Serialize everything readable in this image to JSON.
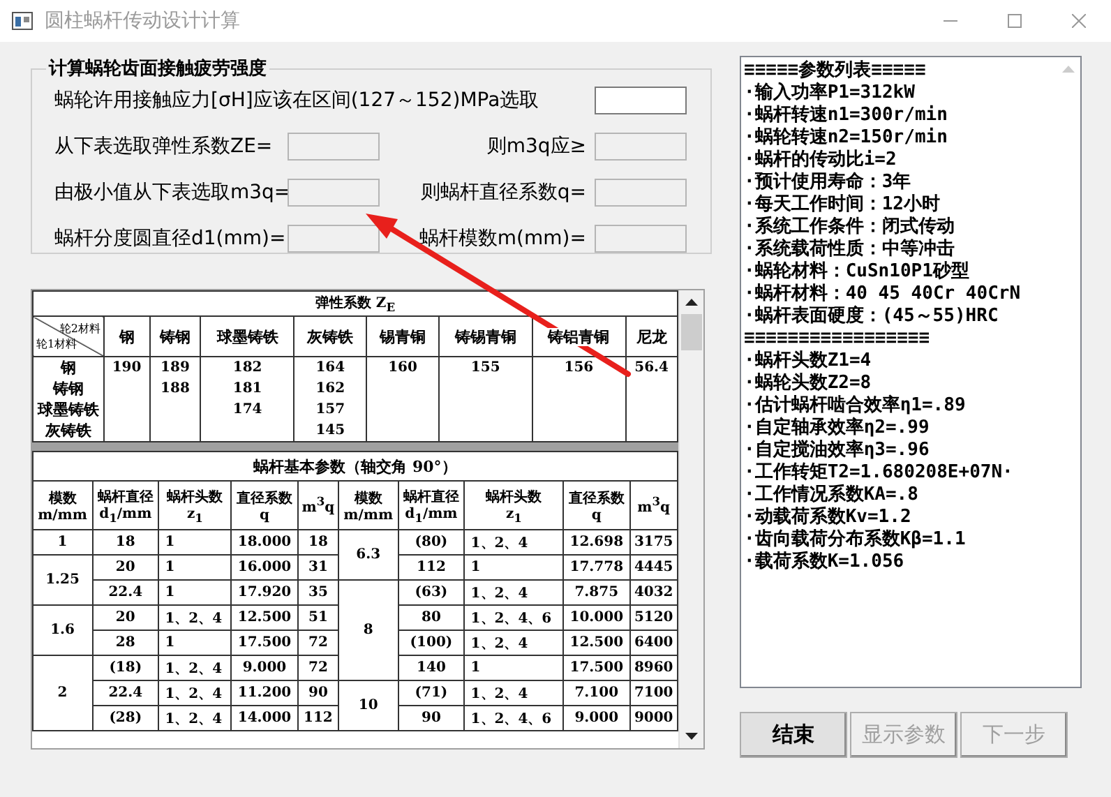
{
  "window": {
    "title": "圆柱蜗杆传动设计计算"
  },
  "form": {
    "legend": "计算蜗轮齿面接触疲劳强度",
    "rows": [
      {
        "fields": [
          {
            "label": "蜗轮许用接触应力[σH]应该在区间(127～152)MPa选取",
            "disabled": false
          }
        ]
      },
      {
        "fields": [
          {
            "label": "从下表选取弹性系数ZE=",
            "disabled": true
          },
          {
            "label": "则m3q应≥",
            "disabled": true
          }
        ]
      },
      {
        "fields": [
          {
            "label": "由极小值从下表选取m3q=",
            "disabled": true
          },
          {
            "label": "则蜗杆直径系数q=",
            "disabled": true
          }
        ]
      },
      {
        "fields": [
          {
            "label": "蜗杆分度圆直径d1(mm)=",
            "disabled": true
          },
          {
            "label": "蜗杆模数m(mm)=",
            "disabled": true
          }
        ]
      }
    ]
  },
  "elastic_table": {
    "title": "弹性系数 Z$_{E}$",
    "corner_top": "轮2材料",
    "corner_bottom": "轮1材料",
    "row_labels": [
      "钢",
      "铸钢",
      "球墨铸铁",
      "灰铸铁"
    ],
    "columns": [
      {
        "label": "钢",
        "values": [
          "190"
        ]
      },
      {
        "label": "铸钢",
        "values": [
          "189",
          "188"
        ]
      },
      {
        "label": "球墨铸铁",
        "values": [
          "182",
          "181",
          "174"
        ]
      },
      {
        "label": "灰铸铁",
        "values": [
          "164",
          "162",
          "157",
          "145"
        ]
      },
      {
        "label": "锡青铜",
        "values": [
          "160"
        ]
      },
      {
        "label": "铸锡青铜",
        "values": [
          "155"
        ]
      },
      {
        "label": "铸铝青铜",
        "values": [
          "156"
        ]
      },
      {
        "label": "尼龙",
        "values": [
          "56.4"
        ]
      }
    ]
  },
  "worm_table": {
    "title": "蜗杆基本参数（轴交角 90°）",
    "columns": [
      {
        "top": "模数",
        "bottom": "m/mm"
      },
      {
        "top": "蜗杆直径",
        "bottom": "d$_{1}$/mm"
      },
      {
        "top": "蜗杆头数",
        "bottom": "z$_{1}$"
      },
      {
        "top": "直径系数",
        "bottom": "q"
      },
      {
        "top": "m$^{3}$q"
      },
      {
        "top": "模数",
        "bottom": "m/mm"
      },
      {
        "top": "蜗杆直径",
        "bottom": "d$_{1}$/mm"
      },
      {
        "top": "蜗杆头数",
        "bottom": "z$_{1}$"
      },
      {
        "top": "直径系数",
        "bottom": "q"
      },
      {
        "top": "m$^{3}$q"
      }
    ],
    "left_groups": [
      {
        "module": "1",
        "rows": [
          [
            "18",
            "1",
            "18.000",
            "18"
          ]
        ]
      },
      {
        "module": "1.25",
        "rows": [
          [
            "20",
            "1",
            "16.000",
            "31"
          ],
          [
            "22.4",
            "1",
            "17.920",
            "35"
          ]
        ]
      },
      {
        "module": "1.6",
        "rows": [
          [
            "20",
            "1、2、4",
            "12.500",
            "51"
          ],
          [
            "28",
            "1",
            "17.500",
            "72"
          ]
        ]
      },
      {
        "module": "2",
        "rows": [
          [
            "(18)",
            "1、2、4",
            "9.000",
            "72"
          ],
          [
            "22.4",
            "1、2、4",
            "11.200",
            "90"
          ],
          [
            "(28)",
            "1、2、4",
            "14.000",
            "112"
          ]
        ]
      }
    ],
    "right_groups": [
      {
        "module": "6.3",
        "rows": [
          [
            "(80)",
            "1、2、4",
            "12.698",
            "3175"
          ],
          [
            "112",
            "1",
            "17.778",
            "4445"
          ]
        ]
      },
      {
        "module": "8",
        "rows": [
          [
            "(63)",
            "1、2、4",
            "7.875",
            "4032"
          ],
          [
            "80",
            "1、2、4、6",
            "10.000",
            "5120"
          ],
          [
            "(100)",
            "1、2、4",
            "12.500",
            "6400"
          ],
          [
            "140",
            "1",
            "17.500",
            "8960"
          ]
        ]
      },
      {
        "module": "10",
        "rows": [
          [
            "(71)",
            "1、2、4",
            "7.100",
            "7100"
          ],
          [
            "90",
            "1、2、4、6",
            "9.000",
            "9000"
          ]
        ]
      }
    ]
  },
  "param_list": [
    "≡≡≡≡≡参数列表≡≡≡≡≡",
    "·输入功率P1=312kW",
    "·蜗杆转速n1=300r/min",
    "·蜗轮转速n2=150r/min",
    "·蜗杆的传动比i=2",
    "·预计使用寿命：3年",
    "·每天工作时间：12小时",
    "·系统工作条件：闭式传动",
    "·系统载荷性质：中等冲击",
    "·蜗轮材料：CuSn10P1砂型",
    "·蜗杆材料：40 45 40Cr 40CrN",
    "·蜗杆表面硬度：(45～55)HRC",
    "≡≡≡≡≡≡≡≡≡≡≡≡≡≡≡≡≡",
    "·蜗杆头数Z1=4",
    "·蜗轮头数Z2=8",
    "·估计蜗杆啮合效率η1=.89",
    "·自定轴承效率η2=.99",
    "·自定搅油效率η3=.96",
    "·工作转矩T2=1.680208E+07N·",
    "·工作情况系数KA=.8",
    "·动载荷系数Kv=1.2",
    "·齿向载荷分布系数Kβ=1.1",
    "·载荷系数K=1.056"
  ],
  "buttons": [
    {
      "label": "结束",
      "disabled": false
    },
    {
      "label": "显示参数",
      "disabled": true
    },
    {
      "label": "下一步",
      "disabled": true
    }
  ]
}
